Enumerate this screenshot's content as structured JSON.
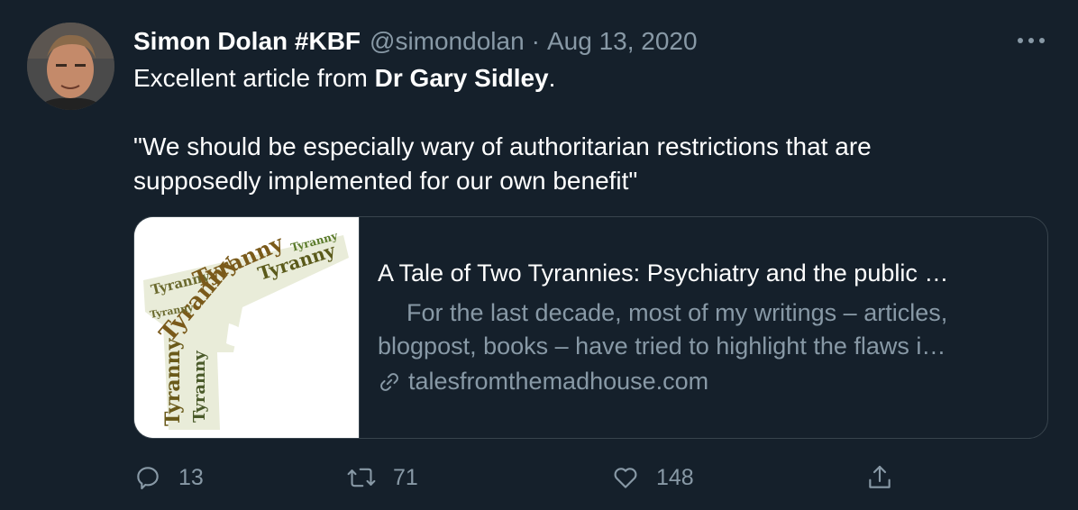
{
  "tweet": {
    "author_name": "Simon Dolan #KBF",
    "handle": "@simondolan",
    "separator": "·",
    "date": "Aug 13, 2020",
    "text_prefix": "Excellent article from ",
    "text_bold": "Dr Gary Sidley",
    "text_suffix": ".",
    "quote_line1": "\"We should be especially wary of authoritarian restrictions that are",
    "quote_line2": "supposedly implemented for our own benefit\""
  },
  "card": {
    "image_words": [
      "Tyranny",
      "Tyranny",
      "Tyranny",
      "Tyranny",
      "Tyranny",
      "Tyranny",
      "Tyranny",
      "Tyranny"
    ],
    "title": "A Tale of Two Tyrannies: Psychiatry and the public …",
    "description_line1": "For the last decade, most of my writings – articles,",
    "description_line2": "blogpost, books – have tried to highlight the flaws i…",
    "domain": "talesfromthemadhouse.com"
  },
  "actions": {
    "replies": "13",
    "retweets": "71",
    "likes": "148"
  },
  "icons": {
    "reply": "reply-icon",
    "retweet": "retweet-icon",
    "like": "heart-icon",
    "share": "share-icon",
    "link": "link-icon",
    "more": "more-icon"
  },
  "colors": {
    "background": "#15202b",
    "secondary_text": "#8899a6",
    "border": "#38444d"
  }
}
